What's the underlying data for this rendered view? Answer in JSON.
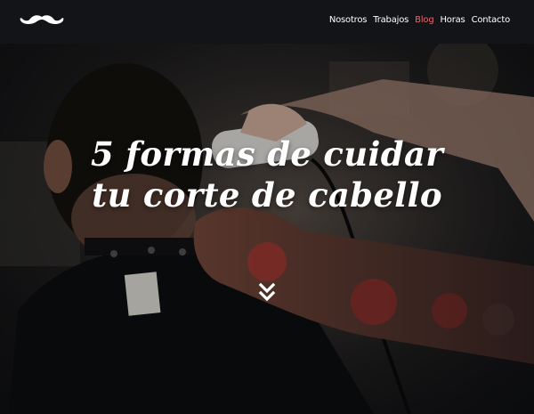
{
  "header": {
    "logo_icon": "mustache-icon",
    "nav": [
      {
        "label": "Nosotros",
        "active": false
      },
      {
        "label": "Trabajos",
        "active": false
      },
      {
        "label": "Blog",
        "active": true
      },
      {
        "label": "Horas",
        "active": false
      },
      {
        "label": "Contacto",
        "active": false
      }
    ]
  },
  "hero": {
    "title_line1": "5 formas de cuidar",
    "title_line2": "tu corte de cabello",
    "scroll_icon": "double-chevron-down-icon"
  },
  "colors": {
    "nav_bg": "#121417",
    "nav_text": "#ffffff",
    "nav_active": "#e5686f"
  }
}
